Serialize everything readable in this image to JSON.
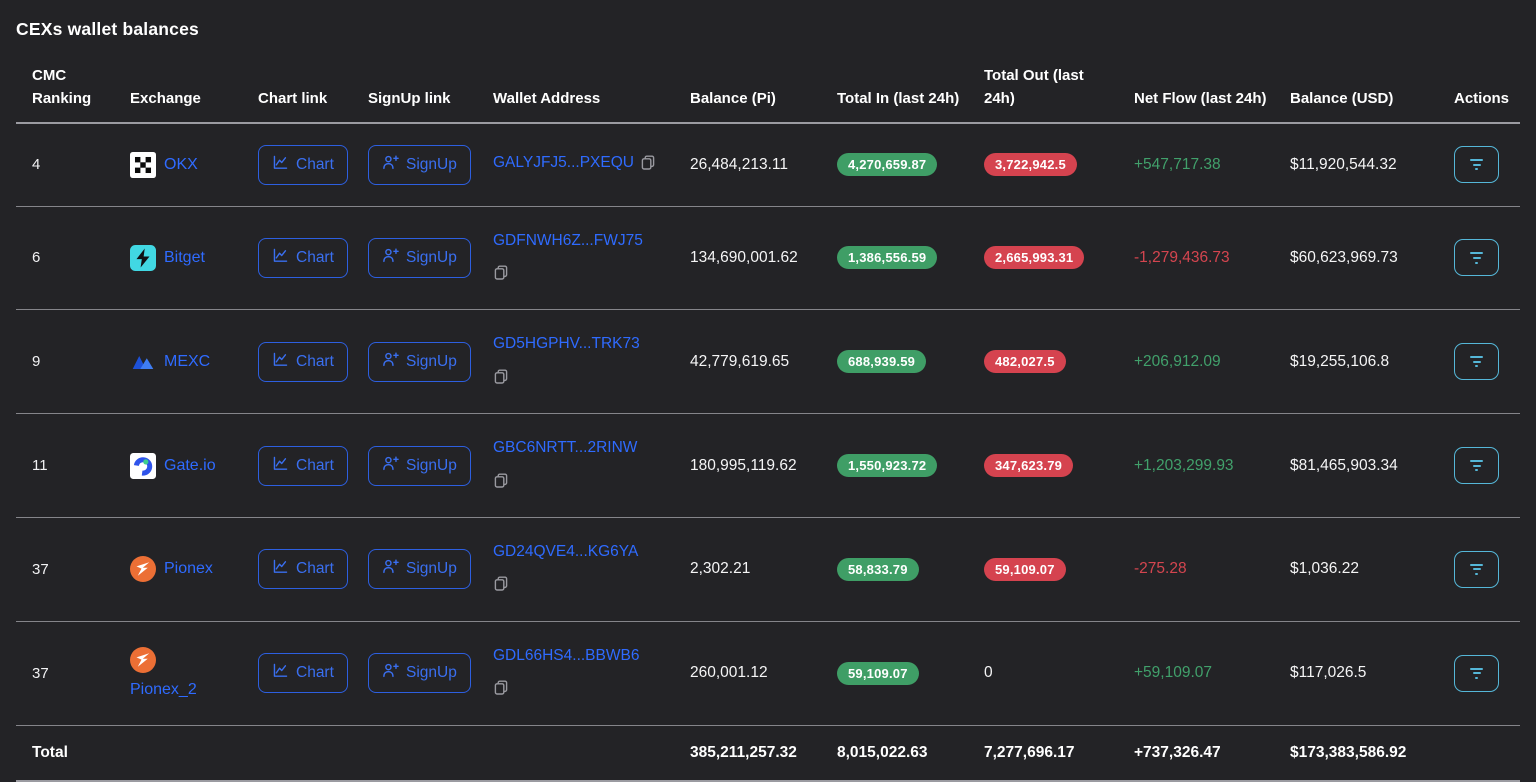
{
  "page": {
    "title": "CEXs wallet balances"
  },
  "colors": {
    "background": "#232326",
    "link_blue": "#2f6bff",
    "button_blue": "#2d5fe0",
    "badge_green": "#3f9e66",
    "badge_red": "#d5434f",
    "flow_positive_green": "#41a06b",
    "flow_negative_red": "#d4454f",
    "actions_cyan": "#55b7d8",
    "separator_gray": "#9b9ba1"
  },
  "table": {
    "columns": [
      "CMC Ranking",
      "Exchange",
      "Chart link",
      "SignUp link",
      "Wallet Address",
      "Balance (Pi)",
      "Total In (last 24h)",
      "Total Out (last 24h)",
      "Net Flow (last 24h)",
      "Balance (USD)",
      "Actions"
    ],
    "chart_button_label": "Chart",
    "signup_button_label": "SignUp",
    "rows": [
      {
        "rank": "4",
        "exchange": "OKX",
        "icon": "okx-logo-icon",
        "stacked": false,
        "wallet": "GALYJFJ5...PXEQU",
        "copy_below": false,
        "balance_pi": "26,484,213.11",
        "total_in": "4,270,659.87",
        "total_out": "3,722,942.5",
        "total_out_badge": true,
        "net_flow": "+547,717.38",
        "net_flow_positive": true,
        "balance_usd": "$11,920,544.32"
      },
      {
        "rank": "6",
        "exchange": "Bitget",
        "icon": "bitget-logo-icon",
        "stacked": false,
        "wallet": "GDFNWH6Z...FWJ75",
        "copy_below": true,
        "balance_pi": "134,690,001.62",
        "total_in": "1,386,556.59",
        "total_out": "2,665,993.31",
        "total_out_badge": true,
        "net_flow": "-1,279,436.73",
        "net_flow_positive": false,
        "balance_usd": "$60,623,969.73"
      },
      {
        "rank": "9",
        "exchange": "MEXC",
        "icon": "mexc-logo-icon",
        "stacked": false,
        "wallet": "GD5HGPHV...TRK73",
        "copy_below": true,
        "balance_pi": "42,779,619.65",
        "total_in": "688,939.59",
        "total_out": "482,027.5",
        "total_out_badge": true,
        "net_flow": "+206,912.09",
        "net_flow_positive": true,
        "balance_usd": "$19,255,106.8"
      },
      {
        "rank": "11",
        "exchange": "Gate.io",
        "icon": "gateio-logo-icon",
        "stacked": false,
        "wallet": "GBC6NRTT...2RINW",
        "copy_below": true,
        "balance_pi": "180,995,119.62",
        "total_in": "1,550,923.72",
        "total_out": "347,623.79",
        "total_out_badge": true,
        "net_flow": "+1,203,299.93",
        "net_flow_positive": true,
        "balance_usd": "$81,465,903.34"
      },
      {
        "rank": "37",
        "exchange": "Pionex",
        "icon": "pionex-logo-icon",
        "stacked": false,
        "wallet": "GD24QVE4...KG6YA",
        "copy_below": true,
        "balance_pi": "2,302.21",
        "total_in": "58,833.79",
        "total_out": "59,109.07",
        "total_out_badge": true,
        "net_flow": "-275.28",
        "net_flow_positive": false,
        "balance_usd": "$1,036.22"
      },
      {
        "rank": "37",
        "exchange": "Pionex_2",
        "icon": "pionex-logo-icon",
        "stacked": true,
        "wallet": "GDL66HS4...BBWB6",
        "copy_below": true,
        "balance_pi": "260,001.12",
        "total_in": "59,109.07",
        "total_out": "0",
        "total_out_badge": false,
        "net_flow": "+59,109.07",
        "net_flow_positive": true,
        "balance_usd": "$117,026.5"
      }
    ],
    "total": {
      "label": "Total",
      "balance_pi": "385,211,257.32",
      "total_in": "8,015,022.63",
      "total_out": "7,277,696.17",
      "net_flow": "+737,326.47",
      "net_flow_positive": true,
      "balance_usd": "$173,383,586.92"
    }
  }
}
